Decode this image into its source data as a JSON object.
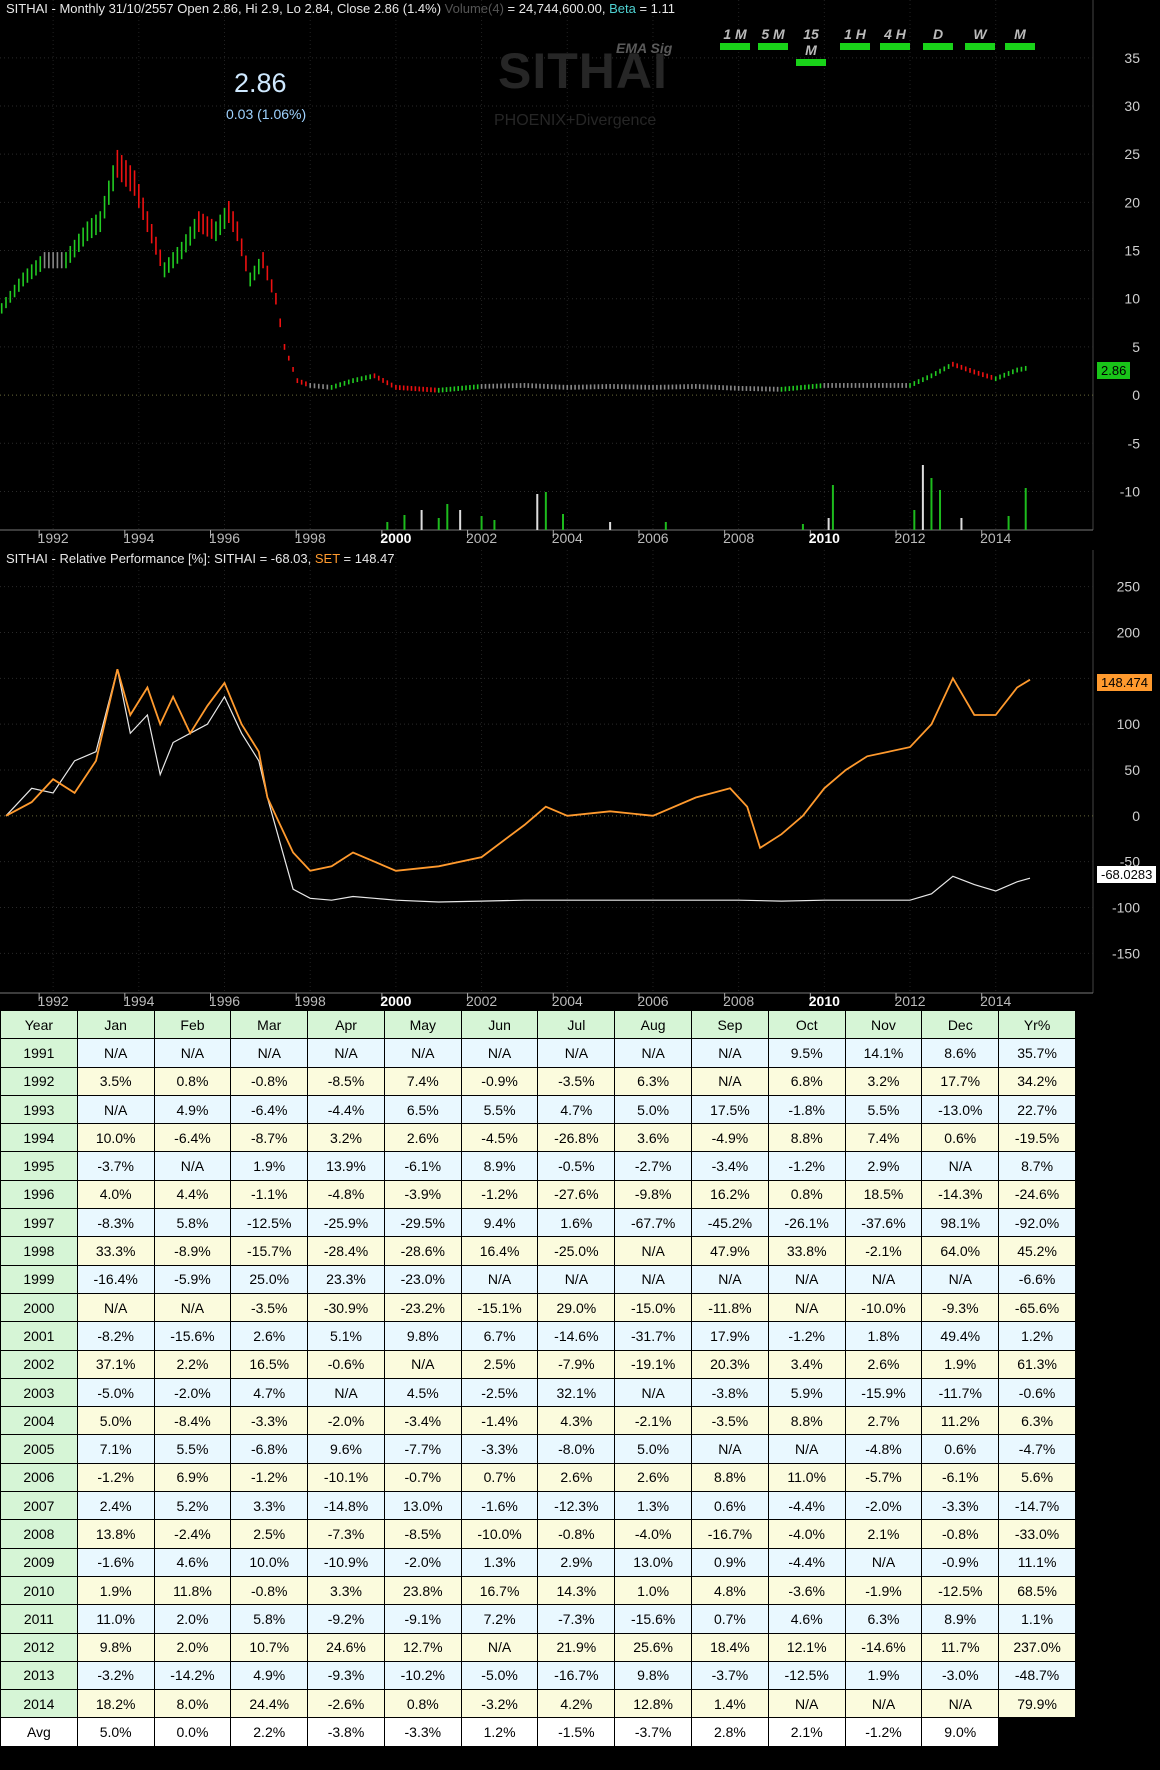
{
  "header": {
    "symbol": "SITHAI",
    "title_main": "SITHAI - Monthly 31/10/2557 Open 2.86, Hi 2.9, Lo 2.84, Close 2.86 (1.4%)",
    "volume_label": "Volume(4)",
    "volume_value": " = 24,744,600.00, ",
    "beta_label": "Beta",
    "beta_value": " = 1.11"
  },
  "quote": {
    "last": "2.86",
    "change": "0.03 (1.06%)"
  },
  "watermark": {
    "name": "SITHAI",
    "system": "PHOENIX+Divergence",
    "indicator": "EMA Sig"
  },
  "timeframes": [
    "1 M",
    "5 M",
    "15 M",
    "1 H",
    "4 H",
    "D",
    "W",
    "M"
  ],
  "rp_header": {
    "prefix": "SITHAI - Relative Performance [%]: SITHAI = -68.03, ",
    "set_label": "SET",
    "set_value": " = 148.47"
  },
  "colors": {
    "up": "#22cc22",
    "down": "#ee1111",
    "neutral": "#888888",
    "set_line": "#ff9a2e",
    "stock_line": "#e8e8e8"
  },
  "chart_data": [
    {
      "type": "line",
      "title": "SITHAI - Monthly",
      "x_ticks": [
        "1992",
        "1994",
        "1996",
        "1998",
        "2000",
        "2002",
        "2004",
        "2006",
        "2008",
        "2010",
        "2012",
        "2014"
      ],
      "y_ticks": [
        35,
        30,
        25,
        20,
        15,
        10,
        5,
        0,
        -5,
        -10
      ],
      "ylim": [
        -14,
        41
      ],
      "last_value_label": "2.86",
      "series": [
        {
          "x": [
            1990.8,
            1991.3,
            1991.8,
            1992.3,
            1992.8,
            1993.1,
            1993.5,
            1993.9,
            1994.2,
            1994.6,
            1995.0,
            1995.4,
            1995.8,
            1996.1,
            1996.3,
            1996.6,
            1996.9,
            1997.2,
            1997.4,
            1997.7,
            1998.0,
            1998.5,
            1999.0,
            1999.5,
            2000.0,
            2001.0,
            2002.0,
            2003.0,
            2004.0,
            2005.0,
            2006.0,
            2007.0,
            2008.0,
            2009.0,
            2010.0,
            2011.0,
            2012.0,
            2012.5,
            2013.0,
            2013.5,
            2014.0,
            2014.5,
            2014.8
          ],
          "y": [
            9,
            12,
            14,
            14,
            17,
            18,
            24,
            22,
            18,
            13,
            15,
            18,
            17,
            19,
            17,
            12,
            14,
            10,
            5,
            1.5,
            1.0,
            0.8,
            1.5,
            2.0,
            0.8,
            0.5,
            0.9,
            1.0,
            0.8,
            0.9,
            0.8,
            0.9,
            0.7,
            0.6,
            1.0,
            1.0,
            1.0,
            2.0,
            3.2,
            2.4,
            1.7,
            2.6,
            2.86
          ]
        }
      ],
      "volume_note": "Volume(4)"
    },
    {
      "type": "line",
      "title": "SITHAI - Relative Performance [%]",
      "x_ticks": [
        "1992",
        "1994",
        "1996",
        "1998",
        "2000",
        "2002",
        "2004",
        "2006",
        "2008",
        "2010",
        "2012",
        "2014"
      ],
      "y_ticks": [
        250,
        200,
        150,
        100,
        50,
        0,
        -50,
        -100,
        -150
      ],
      "ylim": [
        -190,
        290
      ],
      "series": [
        {
          "name": "SITHAI",
          "last_label": "-68.0283",
          "x": [
            1990.9,
            1991.5,
            1992.0,
            1992.5,
            1993.0,
            1993.5,
            1993.8,
            1994.2,
            1994.5,
            1994.8,
            1995.2,
            1995.6,
            1996.0,
            1996.4,
            1996.8,
            1997.0,
            1997.3,
            1997.6,
            1998.0,
            1998.5,
            1999.0,
            1999.5,
            2000.0,
            2001.0,
            2002.0,
            2003.0,
            2004.0,
            2005.0,
            2006.0,
            2007.0,
            2008.0,
            2009.0,
            2010.0,
            2011.0,
            2012.0,
            2012.5,
            2013.0,
            2013.5,
            2014.0,
            2014.5,
            2014.8
          ],
          "y": [
            0,
            30,
            25,
            60,
            70,
            160,
            90,
            110,
            45,
            80,
            90,
            100,
            130,
            90,
            60,
            20,
            -30,
            -80,
            -90,
            -92,
            -88,
            -90,
            -92,
            -94,
            -93,
            -92,
            -92,
            -92,
            -92,
            -92,
            -92,
            -93,
            -92,
            -92,
            -92,
            -85,
            -66,
            -75,
            -82,
            -72,
            -68
          ]
        },
        {
          "name": "SET",
          "last_label": "148.474",
          "x": [
            1990.9,
            1991.5,
            1992.0,
            1992.5,
            1993.0,
            1993.5,
            1993.8,
            1994.2,
            1994.5,
            1994.8,
            1995.2,
            1995.6,
            1996.0,
            1996.4,
            1996.8,
            1997.0,
            1997.3,
            1997.6,
            1998.0,
            1998.5,
            1999.0,
            1999.5,
            2000.0,
            2001.0,
            2002.0,
            2003.0,
            2003.5,
            2004.0,
            2005.0,
            2006.0,
            2007.0,
            2007.8,
            2008.2,
            2008.5,
            2009.0,
            2009.5,
            2010.0,
            2010.5,
            2011.0,
            2011.5,
            2012.0,
            2012.5,
            2013.0,
            2013.5,
            2014.0,
            2014.5,
            2014.8
          ],
          "y": [
            0,
            15,
            40,
            25,
            60,
            160,
            110,
            140,
            100,
            130,
            90,
            120,
            145,
            100,
            70,
            20,
            -10,
            -40,
            -60,
            -55,
            -40,
            -50,
            -60,
            -55,
            -45,
            -10,
            10,
            0,
            5,
            0,
            20,
            30,
            10,
            -35,
            -20,
            0,
            30,
            50,
            65,
            70,
            75,
            100,
            150,
            110,
            110,
            140,
            148.47
          ]
        }
      ]
    }
  ],
  "returns_table": {
    "headers": [
      "Year",
      "Jan",
      "Feb",
      "Mar",
      "Apr",
      "May",
      "Jun",
      "Jul",
      "Aug",
      "Sep",
      "Oct",
      "Nov",
      "Dec",
      "Yr%"
    ],
    "rows": [
      [
        "1991",
        "N/A",
        "N/A",
        "N/A",
        "N/A",
        "N/A",
        "N/A",
        "N/A",
        "N/A",
        "N/A",
        "9.5%",
        "14.1%",
        "8.6%",
        "35.7%"
      ],
      [
        "1992",
        "3.5%",
        "0.8%",
        "-0.8%",
        "-8.5%",
        "7.4%",
        "-0.9%",
        "-3.5%",
        "6.3%",
        "N/A",
        "6.8%",
        "3.2%",
        "17.7%",
        "34.2%"
      ],
      [
        "1993",
        "N/A",
        "4.9%",
        "-6.4%",
        "-4.4%",
        "6.5%",
        "5.5%",
        "4.7%",
        "5.0%",
        "17.5%",
        "-1.8%",
        "5.5%",
        "-13.0%",
        "22.7%"
      ],
      [
        "1994",
        "10.0%",
        "-6.4%",
        "-8.7%",
        "3.2%",
        "2.6%",
        "-4.5%",
        "-26.8%",
        "3.6%",
        "-4.9%",
        "8.8%",
        "7.4%",
        "0.6%",
        "-19.5%"
      ],
      [
        "1995",
        "-3.7%",
        "N/A",
        "1.9%",
        "13.9%",
        "-6.1%",
        "8.9%",
        "-0.5%",
        "-2.7%",
        "-3.4%",
        "-1.2%",
        "2.9%",
        "N/A",
        "8.7%"
      ],
      [
        "1996",
        "4.0%",
        "4.4%",
        "-1.1%",
        "-4.8%",
        "-3.9%",
        "-1.2%",
        "-27.6%",
        "-9.8%",
        "16.2%",
        "0.8%",
        "18.5%",
        "-14.3%",
        "-24.6%"
      ],
      [
        "1997",
        "-8.3%",
        "5.8%",
        "-12.5%",
        "-25.9%",
        "-29.5%",
        "9.4%",
        "1.6%",
        "-67.7%",
        "-45.2%",
        "-26.1%",
        "-37.6%",
        "98.1%",
        "-92.0%"
      ],
      [
        "1998",
        "33.3%",
        "-8.9%",
        "-15.7%",
        "-28.4%",
        "-28.6%",
        "16.4%",
        "-25.0%",
        "N/A",
        "47.9%",
        "33.8%",
        "-2.1%",
        "64.0%",
        "45.2%"
      ],
      [
        "1999",
        "-16.4%",
        "-5.9%",
        "25.0%",
        "23.3%",
        "-23.0%",
        "N/A",
        "N/A",
        "N/A",
        "N/A",
        "N/A",
        "N/A",
        "N/A",
        "-6.6%"
      ],
      [
        "2000",
        "N/A",
        "N/A",
        "-3.5%",
        "-30.9%",
        "-23.2%",
        "-15.1%",
        "29.0%",
        "-15.0%",
        "-11.8%",
        "N/A",
        "-10.0%",
        "-9.3%",
        "-65.6%"
      ],
      [
        "2001",
        "-8.2%",
        "-15.6%",
        "2.6%",
        "5.1%",
        "9.8%",
        "6.7%",
        "-14.6%",
        "-31.7%",
        "17.9%",
        "-1.2%",
        "1.8%",
        "49.4%",
        "1.2%"
      ],
      [
        "2002",
        "37.1%",
        "2.2%",
        "16.5%",
        "-0.6%",
        "N/A",
        "2.5%",
        "-7.9%",
        "-19.1%",
        "20.3%",
        "3.4%",
        "2.6%",
        "1.9%",
        "61.3%"
      ],
      [
        "2003",
        "-5.0%",
        "-2.0%",
        "4.7%",
        "N/A",
        "4.5%",
        "-2.5%",
        "32.1%",
        "N/A",
        "-3.8%",
        "5.9%",
        "-15.9%",
        "-11.7%",
        "-0.6%"
      ],
      [
        "2004",
        "5.0%",
        "-8.4%",
        "-3.3%",
        "-2.0%",
        "-3.4%",
        "-1.4%",
        "4.3%",
        "-2.1%",
        "-3.5%",
        "8.8%",
        "2.7%",
        "11.2%",
        "6.3%"
      ],
      [
        "2005",
        "7.1%",
        "5.5%",
        "-6.8%",
        "9.6%",
        "-7.7%",
        "-3.3%",
        "-8.0%",
        "5.0%",
        "N/A",
        "N/A",
        "-4.8%",
        "0.6%",
        "-4.7%"
      ],
      [
        "2006",
        "-1.2%",
        "6.9%",
        "-1.2%",
        "-10.1%",
        "-0.7%",
        "0.7%",
        "2.6%",
        "2.6%",
        "8.8%",
        "11.0%",
        "-5.7%",
        "-6.1%",
        "5.6%"
      ],
      [
        "2007",
        "2.4%",
        "5.2%",
        "3.3%",
        "-14.8%",
        "13.0%",
        "-1.6%",
        "-12.3%",
        "1.3%",
        "0.6%",
        "-4.4%",
        "-2.0%",
        "-3.3%",
        "-14.7%"
      ],
      [
        "2008",
        "13.8%",
        "-2.4%",
        "2.5%",
        "-7.3%",
        "-8.5%",
        "-10.0%",
        "-0.8%",
        "-4.0%",
        "-16.7%",
        "-4.0%",
        "2.1%",
        "-0.8%",
        "-33.0%"
      ],
      [
        "2009",
        "-1.6%",
        "4.6%",
        "10.0%",
        "-10.9%",
        "-2.0%",
        "1.3%",
        "2.9%",
        "13.0%",
        "0.9%",
        "-4.4%",
        "N/A",
        "-0.9%",
        "11.1%"
      ],
      [
        "2010",
        "1.9%",
        "11.8%",
        "-0.8%",
        "3.3%",
        "23.8%",
        "16.7%",
        "14.3%",
        "1.0%",
        "4.8%",
        "-3.6%",
        "-1.9%",
        "-12.5%",
        "68.5%"
      ],
      [
        "2011",
        "11.0%",
        "2.0%",
        "5.8%",
        "-9.2%",
        "-9.1%",
        "7.2%",
        "-7.3%",
        "-15.6%",
        "0.7%",
        "4.6%",
        "6.3%",
        "8.9%",
        "1.1%"
      ],
      [
        "2012",
        "9.8%",
        "2.0%",
        "10.7%",
        "24.6%",
        "12.7%",
        "N/A",
        "21.9%",
        "25.6%",
        "18.4%",
        "12.1%",
        "-14.6%",
        "11.7%",
        "237.0%"
      ],
      [
        "2013",
        "-3.2%",
        "-14.2%",
        "4.9%",
        "-9.3%",
        "-10.2%",
        "-5.0%",
        "-16.7%",
        "9.8%",
        "-3.7%",
        "-12.5%",
        "1.9%",
        "-3.0%",
        "-48.7%"
      ],
      [
        "2014",
        "18.2%",
        "8.0%",
        "24.4%",
        "-2.6%",
        "0.8%",
        "-3.2%",
        "4.2%",
        "12.8%",
        "1.4%",
        "N/A",
        "N/A",
        "N/A",
        "79.9%"
      ]
    ],
    "avg_row": [
      "Avg",
      "5.0%",
      "0.0%",
      "2.2%",
      "-3.8%",
      "-3.3%",
      "1.2%",
      "-1.5%",
      "-3.7%",
      "2.8%",
      "2.1%",
      "-1.2%",
      "9.0%"
    ]
  }
}
